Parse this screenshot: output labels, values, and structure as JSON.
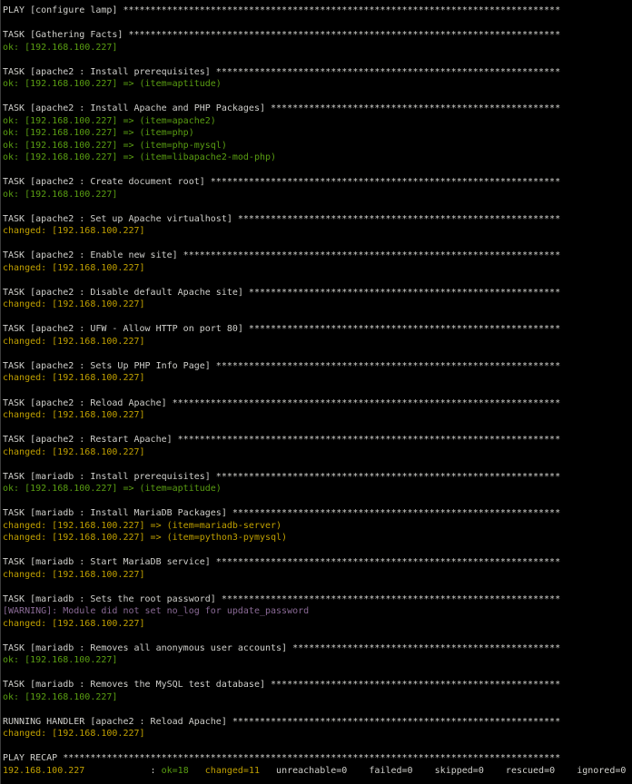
{
  "colors": {
    "ok": "#5a9e12",
    "changed": "#c0a000",
    "warning": "#8a6a96",
    "default": "#d0d0cc",
    "background": "#000000"
  },
  "lines": [
    {
      "kind": "header",
      "segments": [
        {
          "t": "PLAY [configure lamp]",
          "c": "default"
        }
      ]
    },
    {
      "kind": "blank",
      "segments": []
    },
    {
      "kind": "header",
      "segments": [
        {
          "t": "TASK [Gathering Facts]",
          "c": "default"
        }
      ]
    },
    {
      "kind": "result",
      "segments": [
        {
          "t": "ok: [192.168.100.227]",
          "c": "ok"
        }
      ]
    },
    {
      "kind": "blank",
      "segments": []
    },
    {
      "kind": "header",
      "segments": [
        {
          "t": "TASK [apache2 : Install prerequisites]",
          "c": "default"
        }
      ]
    },
    {
      "kind": "result",
      "segments": [
        {
          "t": "ok: [192.168.100.227] => (item=aptitude)",
          "c": "ok"
        }
      ]
    },
    {
      "kind": "blank",
      "segments": []
    },
    {
      "kind": "header",
      "segments": [
        {
          "t": "TASK [apache2 : Install Apache and PHP Packages]",
          "c": "default"
        }
      ]
    },
    {
      "kind": "result",
      "segments": [
        {
          "t": "ok: [192.168.100.227] => (item=apache2)",
          "c": "ok"
        }
      ]
    },
    {
      "kind": "result",
      "segments": [
        {
          "t": "ok: [192.168.100.227] => (item=php)",
          "c": "ok"
        }
      ]
    },
    {
      "kind": "result",
      "segments": [
        {
          "t": "ok: [192.168.100.227] => (item=php-mysql)",
          "c": "ok"
        }
      ]
    },
    {
      "kind": "result",
      "segments": [
        {
          "t": "ok: [192.168.100.227] => (item=libapache2-mod-php)",
          "c": "ok"
        }
      ]
    },
    {
      "kind": "blank",
      "segments": []
    },
    {
      "kind": "header",
      "segments": [
        {
          "t": "TASK [apache2 : Create document root]",
          "c": "default"
        }
      ]
    },
    {
      "kind": "result",
      "segments": [
        {
          "t": "ok: [192.168.100.227]",
          "c": "ok"
        }
      ]
    },
    {
      "kind": "blank",
      "segments": []
    },
    {
      "kind": "header",
      "segments": [
        {
          "t": "TASK [apache2 : Set up Apache virtualhost]",
          "c": "default"
        }
      ]
    },
    {
      "kind": "result",
      "segments": [
        {
          "t": "changed: [192.168.100.227]",
          "c": "changed"
        }
      ]
    },
    {
      "kind": "blank",
      "segments": []
    },
    {
      "kind": "header",
      "segments": [
        {
          "t": "TASK [apache2 : Enable new site]",
          "c": "default"
        }
      ]
    },
    {
      "kind": "result",
      "segments": [
        {
          "t": "changed: [192.168.100.227]",
          "c": "changed"
        }
      ]
    },
    {
      "kind": "blank",
      "segments": []
    },
    {
      "kind": "header",
      "segments": [
        {
          "t": "TASK [apache2 : Disable default Apache site]",
          "c": "default"
        }
      ]
    },
    {
      "kind": "result",
      "segments": [
        {
          "t": "changed: [192.168.100.227]",
          "c": "changed"
        }
      ]
    },
    {
      "kind": "blank",
      "segments": []
    },
    {
      "kind": "header",
      "segments": [
        {
          "t": "TASK [apache2 : UFW - Allow HTTP on port 80]",
          "c": "default"
        }
      ]
    },
    {
      "kind": "result",
      "segments": [
        {
          "t": "changed: [192.168.100.227]",
          "c": "changed"
        }
      ]
    },
    {
      "kind": "blank",
      "segments": []
    },
    {
      "kind": "header",
      "segments": [
        {
          "t": "TASK [apache2 : Sets Up PHP Info Page]",
          "c": "default"
        }
      ]
    },
    {
      "kind": "result",
      "segments": [
        {
          "t": "changed: [192.168.100.227]",
          "c": "changed"
        }
      ]
    },
    {
      "kind": "blank",
      "segments": []
    },
    {
      "kind": "header",
      "segments": [
        {
          "t": "TASK [apache2 : Reload Apache]",
          "c": "default"
        }
      ]
    },
    {
      "kind": "result",
      "segments": [
        {
          "t": "changed: [192.168.100.227]",
          "c": "changed"
        }
      ]
    },
    {
      "kind": "blank",
      "segments": []
    },
    {
      "kind": "header",
      "segments": [
        {
          "t": "TASK [apache2 : Restart Apache]",
          "c": "default"
        }
      ]
    },
    {
      "kind": "result",
      "segments": [
        {
          "t": "changed: [192.168.100.227]",
          "c": "changed"
        }
      ]
    },
    {
      "kind": "blank",
      "segments": []
    },
    {
      "kind": "header",
      "segments": [
        {
          "t": "TASK [mariadb : Install prerequisites]",
          "c": "default"
        }
      ]
    },
    {
      "kind": "result",
      "segments": [
        {
          "t": "ok: [192.168.100.227] => (item=aptitude)",
          "c": "ok"
        }
      ]
    },
    {
      "kind": "blank",
      "segments": []
    },
    {
      "kind": "header",
      "segments": [
        {
          "t": "TASK [mariadb : Install MariaDB Packages]",
          "c": "default"
        }
      ]
    },
    {
      "kind": "result",
      "segments": [
        {
          "t": "changed: [192.168.100.227] => (item=mariadb-server)",
          "c": "changed"
        }
      ]
    },
    {
      "kind": "result",
      "segments": [
        {
          "t": "changed: [192.168.100.227] => (item=python3-pymysql)",
          "c": "changed"
        }
      ]
    },
    {
      "kind": "blank",
      "segments": []
    },
    {
      "kind": "header",
      "segments": [
        {
          "t": "TASK [mariadb : Start MariaDB service]",
          "c": "default"
        }
      ]
    },
    {
      "kind": "result",
      "segments": [
        {
          "t": "changed: [192.168.100.227]",
          "c": "changed"
        }
      ]
    },
    {
      "kind": "blank",
      "segments": []
    },
    {
      "kind": "header",
      "segments": [
        {
          "t": "TASK [mariadb : Sets the root password]",
          "c": "default"
        }
      ]
    },
    {
      "kind": "warning",
      "segments": [
        {
          "t": "[WARNING]: Module did not set no_log for update_password",
          "c": "warning"
        }
      ]
    },
    {
      "kind": "result",
      "segments": [
        {
          "t": "changed: [192.168.100.227]",
          "c": "changed"
        }
      ]
    },
    {
      "kind": "blank",
      "segments": []
    },
    {
      "kind": "header",
      "segments": [
        {
          "t": "TASK [mariadb : Removes all anonymous user accounts]",
          "c": "default"
        }
      ]
    },
    {
      "kind": "result",
      "segments": [
        {
          "t": "ok: [192.168.100.227]",
          "c": "ok"
        }
      ]
    },
    {
      "kind": "blank",
      "segments": []
    },
    {
      "kind": "header",
      "segments": [
        {
          "t": "TASK [mariadb : Removes the MySQL test database]",
          "c": "default"
        }
      ]
    },
    {
      "kind": "result",
      "segments": [
        {
          "t": "ok: [192.168.100.227]",
          "c": "ok"
        }
      ]
    },
    {
      "kind": "blank",
      "segments": []
    },
    {
      "kind": "header",
      "segments": [
        {
          "t": "RUNNING HANDLER [apache2 : Reload Apache]",
          "c": "default"
        }
      ]
    },
    {
      "kind": "result",
      "segments": [
        {
          "t": "changed: [192.168.100.227]",
          "c": "changed"
        }
      ]
    },
    {
      "kind": "blank",
      "segments": []
    },
    {
      "kind": "header",
      "segments": [
        {
          "t": "PLAY RECAP",
          "c": "default"
        }
      ]
    },
    {
      "kind": "recap",
      "segments": [
        {
          "t": "192.168.100.227",
          "c": "changed"
        },
        {
          "t": "            : ",
          "c": "default"
        },
        {
          "t": "ok=18",
          "c": "ok"
        },
        {
          "t": "   ",
          "c": "default"
        },
        {
          "t": "changed=11",
          "c": "changed"
        },
        {
          "t": "   unreachable=0    failed=0    skipped=0    rescued=0    ignored=0",
          "c": "default"
        }
      ]
    }
  ]
}
